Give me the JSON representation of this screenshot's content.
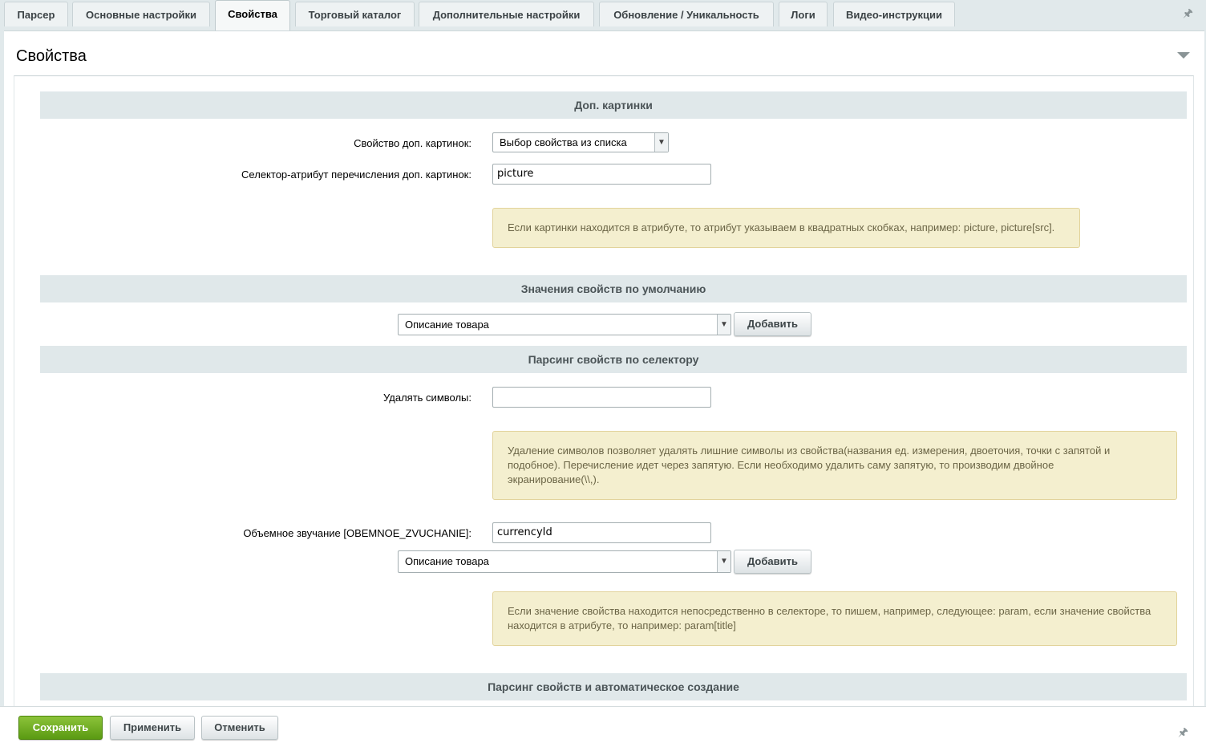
{
  "tabs": [
    {
      "label": "Парсер",
      "active": false
    },
    {
      "label": "Основные настройки",
      "active": false
    },
    {
      "label": "Свойства",
      "active": true
    },
    {
      "label": "Торговый каталог",
      "active": false
    },
    {
      "label": "Дополнительные настройки",
      "active": false
    },
    {
      "label": "Обновление / Уникальность",
      "active": false
    },
    {
      "label": "Логи",
      "active": false
    },
    {
      "label": "Видео-инструкции",
      "active": false
    }
  ],
  "panel": {
    "title": "Свойства"
  },
  "sections": {
    "extra_images": {
      "heading": "Доп. картинки",
      "property_label": "Свойство доп. картинок:",
      "property_value": "Выбор свойства из списка",
      "selector_label": "Селектор-атрибут перечисления доп. картинок:",
      "selector_value": "picture",
      "note": "Если картинки находится в атрибуте, то атрибут указываем в квадратных скобках, например: picture, picture[src]."
    },
    "defaults": {
      "heading": "Значения свойств по умолчанию",
      "select_value": "Описание товара",
      "add_label": "Добавить"
    },
    "selector_parsing": {
      "heading": "Парсинг свойств по селектору",
      "remove_label": "Удалять символы:",
      "remove_value": "",
      "note_line1": "Удаление символов позволяет удалять лишние символы из свойства(названия ед. измерения, двоеточия, точки с запятой и",
      "note_line2": "подобное). Перечисление идет через запятую. Если необходимо удалить саму запятую, то производим двойное",
      "note_line3": "экранирование(\\\\,).",
      "property_label": "Объемное звучание [OBEMNOE_ZVUCHANIE]:",
      "property_value": "currencyId",
      "select_value": "Описание товара",
      "add_label": "Добавить",
      "note2_line1": "Если значение свойства находится непосредственно в селекторе, то пишем, например, следующее: param, если значение свойства",
      "note2_line2": "находится в атрибуте, то например: param[title]"
    },
    "auto_create": {
      "heading": "Парсинг свойств и автоматическое создание"
    }
  },
  "footer": {
    "save_label": "Сохранить",
    "apply_label": "Применить",
    "cancel_label": "Отменить"
  },
  "colors": {
    "save_button": "#6aa81e",
    "note_background": "#f4efcf",
    "section_background": "#e0e8ea"
  }
}
